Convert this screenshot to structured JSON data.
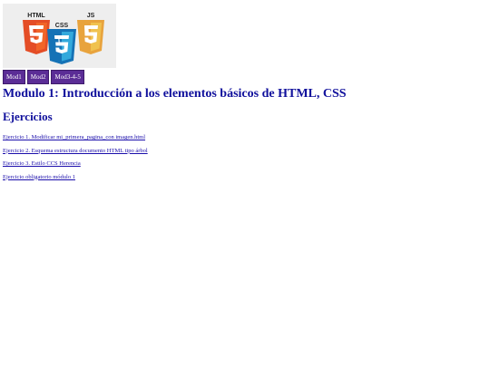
{
  "logo": {
    "labels": [
      "HTML",
      "CSS",
      "JS"
    ],
    "colors": {
      "html": "#e44d26",
      "html_light": "#f16529",
      "css": "#1572b6",
      "css_light": "#33a9dc",
      "js": "#e8a33d",
      "js_light": "#f0db4f",
      "background": "#eeeeee"
    }
  },
  "nav": {
    "items": [
      {
        "label": "Mod1"
      },
      {
        "label": "Mod2"
      },
      {
        "label": "Mod3-4-5"
      }
    ],
    "color": "#5b2d96"
  },
  "title": "Modulo 1: Introducción a los elementos básicos de HTML, CSS",
  "subtitle": "Ejercicios",
  "links": [
    {
      "label": "Ejercicio 1. Modificar mi_primera_pagina_con imagen.html"
    },
    {
      "label": "Ejercicio 2. Esquema estructura documento HTML tipo árbol"
    },
    {
      "label": "Ejercicio 3. Estilo CCS Herencia"
    },
    {
      "label": "Ejercicio obligatorio módulo 1"
    }
  ]
}
